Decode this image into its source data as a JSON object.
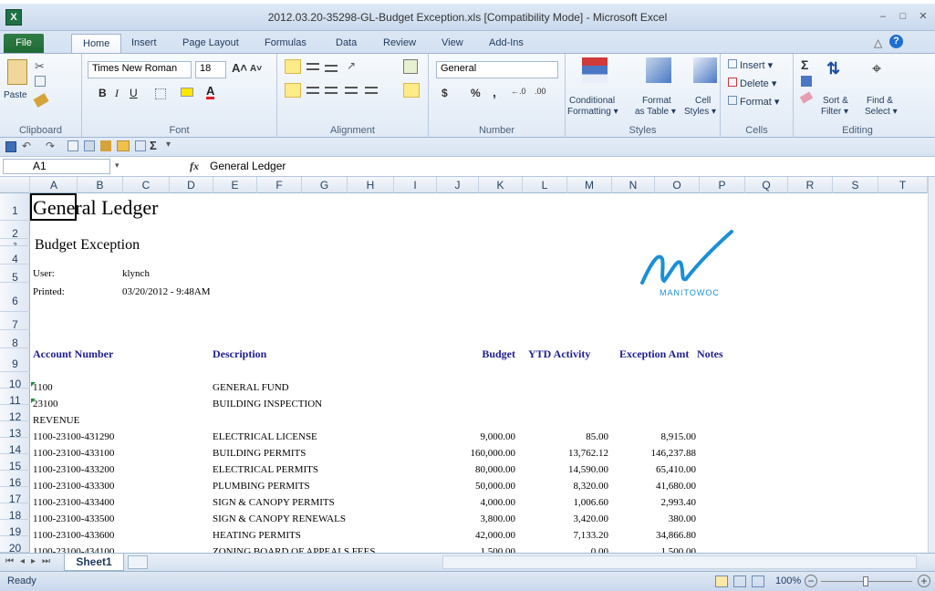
{
  "window": {
    "title": "2012.03.20-35298-GL-Budget Exception.xls  [Compatibility Mode]  -  Microsoft Excel",
    "logo": "X"
  },
  "tabs": [
    "File",
    "Home",
    "Insert",
    "Page Layout",
    "Formulas",
    "Data",
    "Review",
    "View",
    "Add-Ins"
  ],
  "ribbon": {
    "clipboard": {
      "paste": "Paste",
      "label": "Clipboard"
    },
    "font": {
      "name": "Times New Roman",
      "size": "18",
      "bold": "B",
      "italic": "I",
      "underline": "U",
      "label": "Font"
    },
    "alignment": {
      "label": "Alignment"
    },
    "number": {
      "format": "General",
      "currency": "$",
      "percent": "%",
      "comma": ",",
      "label": "Number"
    },
    "styles": {
      "conditional": "Conditional",
      "conditional2": "Formatting ▾",
      "format_table": "Format",
      "format_table2": "as Table ▾",
      "cell": "Cell",
      "cell2": "Styles ▾",
      "label": "Styles"
    },
    "cells": {
      "insert": "Insert ▾",
      "delete": "Delete ▾",
      "format": "Format ▾",
      "label": "Cells"
    },
    "editing": {
      "sort": "Sort &",
      "sort2": "Filter ▾",
      "find": "Find &",
      "find2": "Select ▾",
      "label": "Editing"
    }
  },
  "formula_bar": {
    "cell_ref": "A1",
    "fx": "fx",
    "content": "General Ledger"
  },
  "columns": [
    "A",
    "B",
    "C",
    "D",
    "E",
    "F",
    "G",
    "H",
    "I",
    "J",
    "K",
    "L",
    "M",
    "N",
    "O",
    "P",
    "Q",
    "R",
    "S",
    "T"
  ],
  "rows": [
    "1",
    "2",
    "3",
    "4",
    "5",
    "6",
    "7",
    "8",
    "9",
    "10",
    "11",
    "12",
    "13",
    "14",
    "15",
    "16",
    "17",
    "18",
    "19",
    "20"
  ],
  "sheet": {
    "title": "General Ledger",
    "subtitle": "Budget Exception",
    "user_label": "User:",
    "user": "klynch",
    "printed_label": "Printed:",
    "printed": "03/20/2012 -  9:48AM",
    "headers": {
      "account": "Account Number",
      "description": "Description",
      "budget": "Budget",
      "ytd": "YTD Activity",
      "exception": "Exception Amt",
      "notes": "Notes"
    },
    "fund_code": "1100",
    "fund_name": "GENERAL FUND",
    "dept_code": "23100",
    "dept_name": "BUILDING INSPECTION",
    "revenue": "REVENUE",
    "lines": [
      {
        "account": "1100-23100-431290",
        "desc": "ELECTRICAL LICENSE",
        "budget": "9,000.00",
        "ytd": "85.00",
        "exc": "8,915.00"
      },
      {
        "account": "1100-23100-433100",
        "desc": "BUILDING PERMITS",
        "budget": "160,000.00",
        "ytd": "13,762.12",
        "exc": "146,237.88"
      },
      {
        "account": "1100-23100-433200",
        "desc": "ELECTRICAL PERMITS",
        "budget": "80,000.00",
        "ytd": "14,590.00",
        "exc": "65,410.00"
      },
      {
        "account": "1100-23100-433300",
        "desc": "PLUMBING PERMITS",
        "budget": "50,000.00",
        "ytd": "8,320.00",
        "exc": "41,680.00"
      },
      {
        "account": "1100-23100-433400",
        "desc": "SIGN & CANOPY PERMITS",
        "budget": "4,000.00",
        "ytd": "1,006.60",
        "exc": "2,993.40"
      },
      {
        "account": "1100-23100-433500",
        "desc": "SIGN & CANOPY RENEWALS",
        "budget": "3,800.00",
        "ytd": "3,420.00",
        "exc": "380.00"
      },
      {
        "account": "1100-23100-433600",
        "desc": "HEATING PERMITS",
        "budget": "42,000.00",
        "ytd": "7,133.20",
        "exc": "34,866.80"
      },
      {
        "account": "1100-23100-434100",
        "desc": "ZONING BOARD OF APPEALS FEES",
        "budget": "1,500.00",
        "ytd": "0.00",
        "exc": "1,500.00"
      }
    ],
    "logo_text": "MANITOWOC"
  },
  "sheet_tab": "Sheet1",
  "status": {
    "ready": "Ready",
    "zoom": "100%"
  },
  "colors": {
    "file_tab": "#1f6a35",
    "header_blue": "#1f1f8f",
    "logo_blue": "#1b8fd6"
  }
}
